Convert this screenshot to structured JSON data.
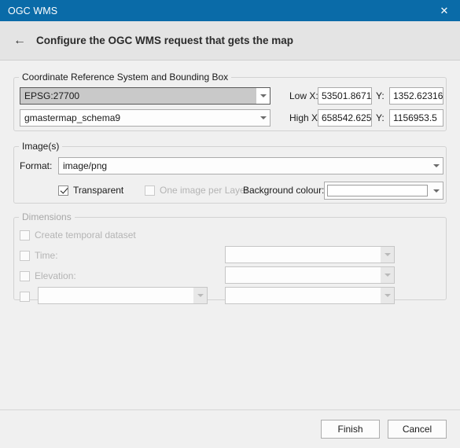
{
  "window": {
    "title": "OGC WMS",
    "close_icon": "close-icon",
    "close_glyph": "✕"
  },
  "header": {
    "back_glyph": "←",
    "title": "Configure the OGC WMS request that gets the map"
  },
  "crs_group": {
    "legend": "Coordinate Reference System and Bounding Box",
    "epsg_value": "EPSG:27700",
    "layer_value": "gmastermap_schema9",
    "low_x_label": "Low X:",
    "low_x_value": "53501.8671",
    "low_y_label": "Y:",
    "low_y_value": "1352.62316",
    "high_x_label": "High X:",
    "high_x_value": "658542.625",
    "high_y_label": "Y:",
    "high_y_value": "1156953.5"
  },
  "image_group": {
    "legend": "Image(s)",
    "format_label": "Format:",
    "format_value": "image/png",
    "transparent_label": "Transparent",
    "transparent_checked": true,
    "one_image_per_layer_label": "One image per Layer",
    "one_image_per_layer_checked": false,
    "background_colour_label": "Background colour:",
    "background_colour_value": "#ffffff"
  },
  "dimensions_group": {
    "legend": "Dimensions",
    "create_temporal_label": "Create temporal dataset",
    "create_temporal_checked": false,
    "time_label": "Time:",
    "time_checked": false,
    "time_value": "",
    "elevation_label": "Elevation:",
    "elevation_checked": false,
    "elevation_value": "",
    "extra_checked": false,
    "extra_name_value": "",
    "extra_value": ""
  },
  "footer": {
    "finish_label": "Finish",
    "cancel_label": "Cancel"
  },
  "colors": {
    "titlebar": "#0a6ba8",
    "dialog_bg": "#f0f0f0",
    "header_bg": "#e4e4e4"
  }
}
